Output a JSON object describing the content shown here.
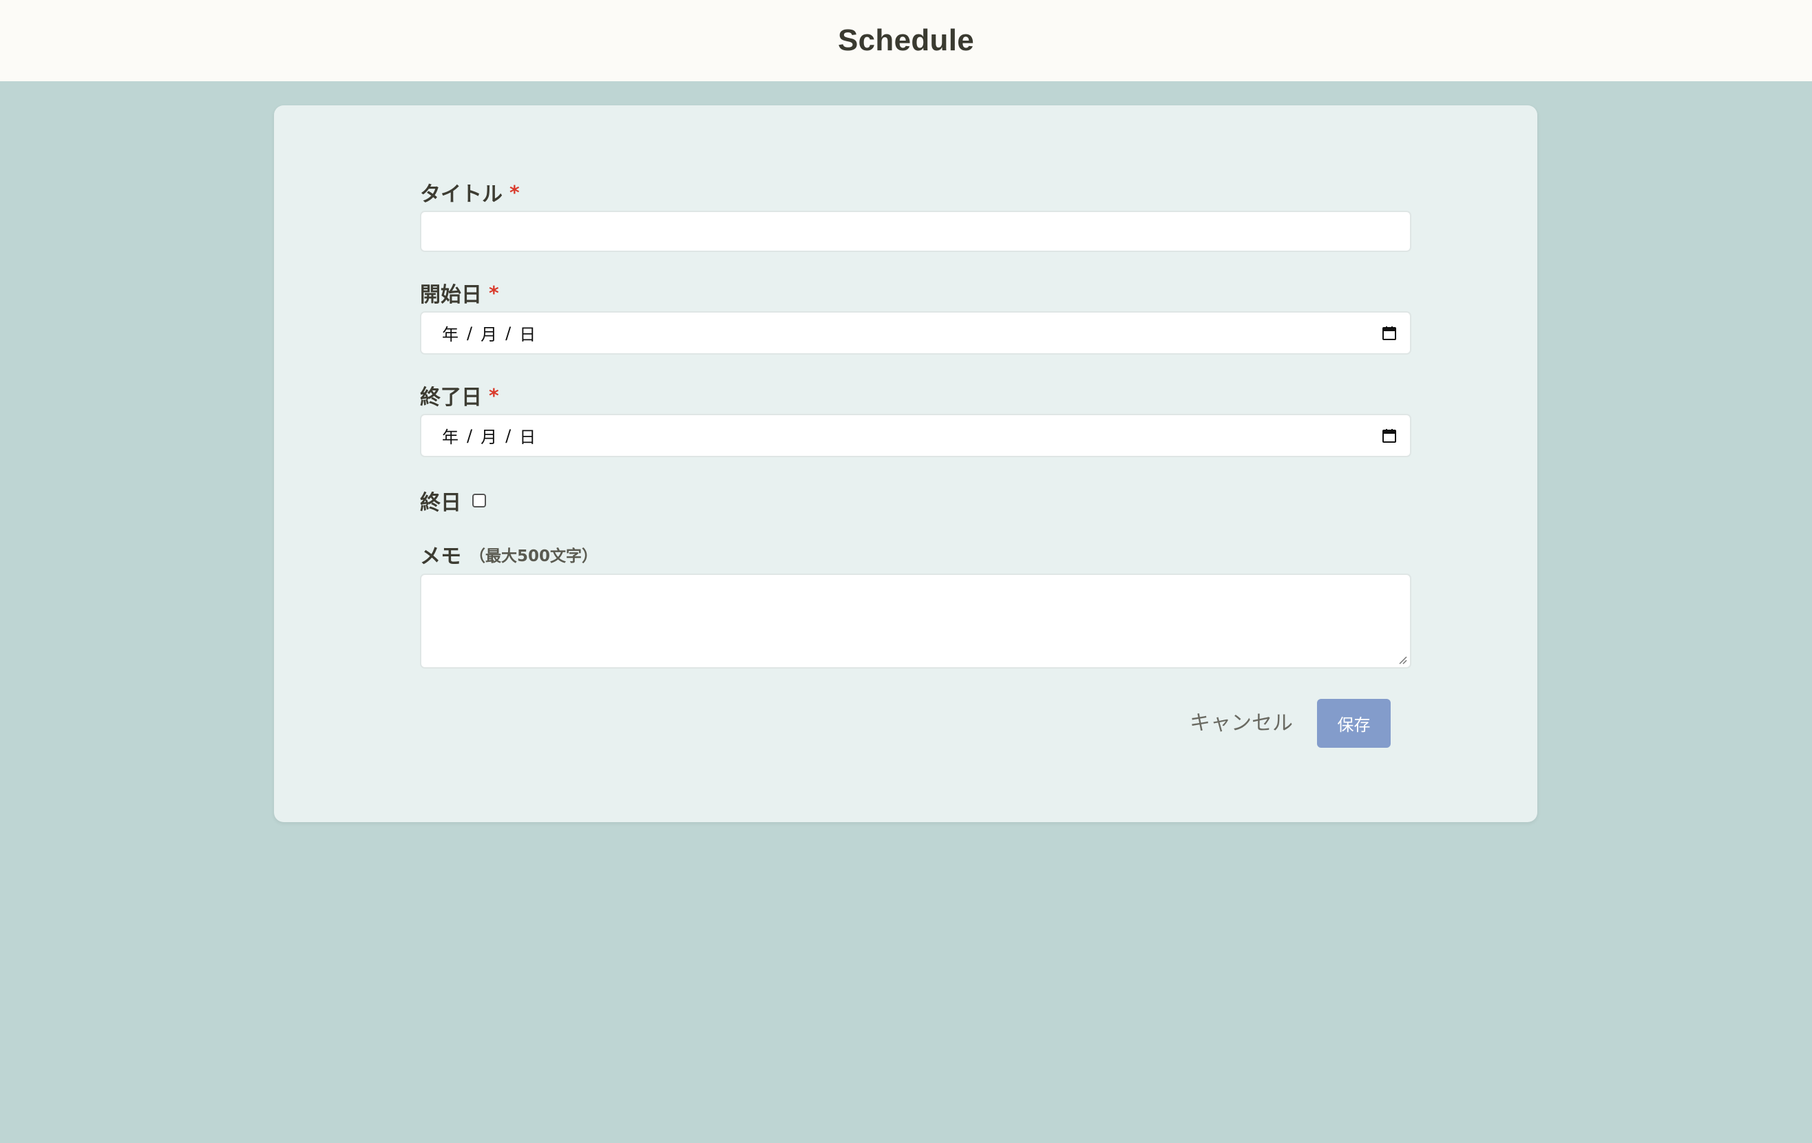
{
  "header": {
    "title": "Schedule"
  },
  "form": {
    "title_field": {
      "label": "タイトル",
      "required_mark": "*",
      "value": ""
    },
    "start_date": {
      "label": "開始日",
      "required_mark": "*",
      "year": "年",
      "month": "月",
      "day": "日",
      "sep": "/"
    },
    "end_date": {
      "label": "終了日",
      "required_mark": "*",
      "year": "年",
      "month": "月",
      "day": "日",
      "sep": "/"
    },
    "all_day": {
      "label": "終日",
      "checked": false
    },
    "memo": {
      "label": "メモ",
      "hint": "（最大500文字）",
      "value": ""
    },
    "cancel_label": "キャンセル",
    "save_label": "保存"
  },
  "colors": {
    "page_bg": "#bed5d3",
    "header_bg": "#fcfbf7",
    "card_bg": "#e8f1f0",
    "required": "#d93a2b",
    "save_button": "#839ccb"
  },
  "icons": [
    "calendar-icon",
    "resize-handle-icon"
  ]
}
